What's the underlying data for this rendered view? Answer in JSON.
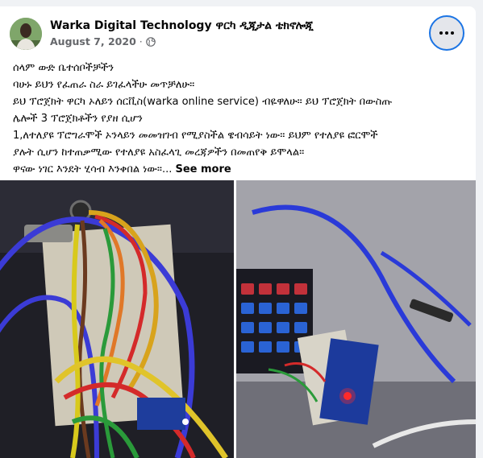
{
  "post": {
    "page_name": "Warka Digital Technology ዋርካ ዲጂታል ቴክኖሎጂ",
    "date": "August 7, 2020",
    "separator": "·",
    "privacy_icon": "globe-icon",
    "more_icon": "more-options-icon",
    "lines": [
      "ሰላም ውድ ቤተሰቦችቻችን",
      "ባሁኑ ይህን የፈጠራ ስራ ይገፈላችሁ መጥቻለሁ።",
      "ይህ ፕሮጀክት ዋርካ ኦለይን ሰርቪስ(warka online service) ብዬዋለሁ። ይህ ፕሮጀክት በውስጡ",
      "ሌሎች 3 ፕሮጀክቶችን የያዘ ሲሆን",
      "1,ለተለያዩ ፕሮግራሞች ኦንላይን መመዝገብ የሚያስችል ዌብሳይት ነው። ይህም የተለያዩ ፎርሞች",
      "ያሉት ሲሆን ከተጠቃሚው የተለያዩ አስፈላጊ መረጃዎችን በመጠየቅ ይሞላል።"
    ],
    "last_line": " ዋናው ነገር እንደት ሂሳብ እንቀበል ነው።...",
    "see_more": "See more"
  }
}
